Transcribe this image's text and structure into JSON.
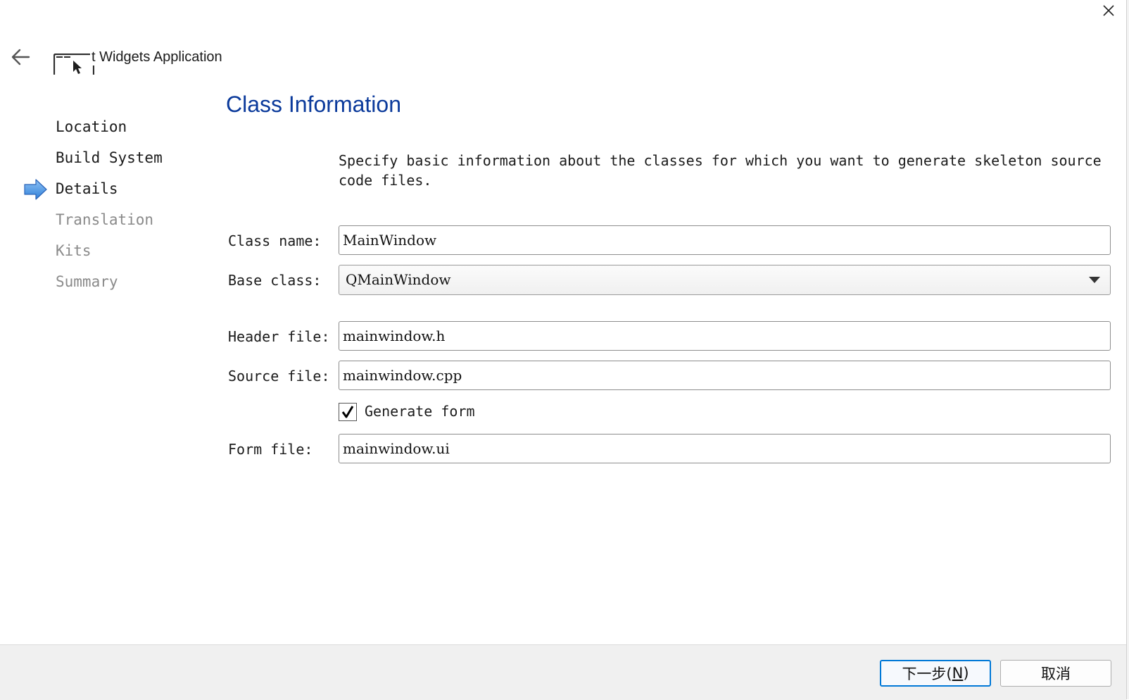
{
  "header": {
    "title": "t Widgets Application",
    "close_icon": "close-icon",
    "back_icon": "back-arrow-icon",
    "app_icon": "window-cursor-icon"
  },
  "steps": [
    {
      "label": "Location",
      "state": "done"
    },
    {
      "label": "Build System",
      "state": "done"
    },
    {
      "label": "Details",
      "state": "current"
    },
    {
      "label": "Translation",
      "state": "future"
    },
    {
      "label": "Kits",
      "state": "future"
    },
    {
      "label": "Summary",
      "state": "future"
    }
  ],
  "page": {
    "title": "Class Information",
    "description_line1": "Specify basic information about the classes for which you want to generate skeleton source",
    "description_line2": "code files."
  },
  "form": {
    "class_name_label": "Class name:",
    "class_name_value": "MainWindow",
    "base_class_label": "Base class:",
    "base_class_value": "QMainWindow",
    "header_file_label": "Header file:",
    "header_file_value": "mainwindow.h",
    "source_file_label": "Source file:",
    "source_file_value": "mainwindow.cpp",
    "generate_form_label": "Generate form",
    "generate_form_checked": true,
    "form_file_label": "Form file:",
    "form_file_value": "mainwindow.ui"
  },
  "footer": {
    "next_label": "下一步(",
    "next_mnemonic": "N",
    "next_suffix": ")",
    "cancel_label": "取消"
  },
  "colors": {
    "title_blue": "#0b3a9b",
    "accent_blue": "#0078d7",
    "arrow_blue": "#3f8fe0"
  }
}
